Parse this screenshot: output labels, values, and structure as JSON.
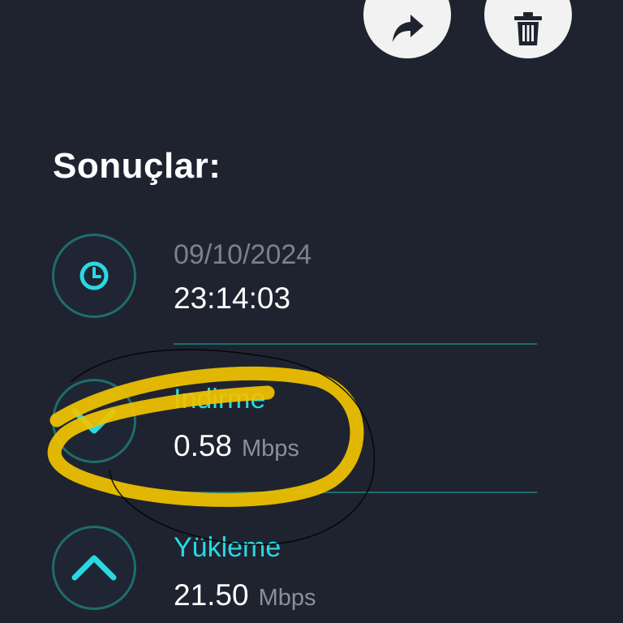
{
  "toolbar": {
    "share_icon": "share-arrow-icon",
    "delete_icon": "trash-icon",
    "button_color": "#f2f2f2",
    "icon_color": "#1f2330"
  },
  "results": {
    "heading": "Sonuçlar:",
    "date": "09/10/2024",
    "time": "23:14:03",
    "download": {
      "label": "İndirme",
      "value": "0.58",
      "unit": "Mbps"
    },
    "upload": {
      "label": "Yükleme",
      "value": "21.50",
      "unit": "Mbps"
    }
  },
  "colors": {
    "background": "#1f2330",
    "accent": "#29d9e2",
    "divider": "#1a6e6d",
    "annotation_highlight": "#f2c400",
    "annotation_outline": "#000000"
  }
}
